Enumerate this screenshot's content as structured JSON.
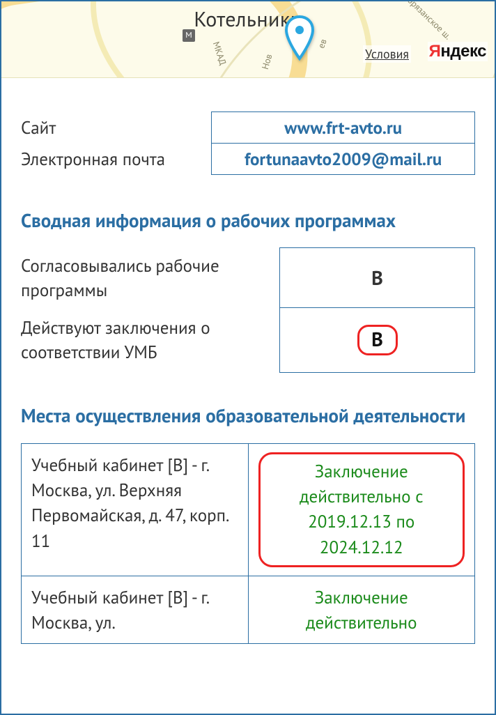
{
  "map": {
    "city": "Котельники",
    "conditions_label": "Условия",
    "provider_first": "Я",
    "provider_rest": "ндекс",
    "road_label_1": "Новорязанское ш.",
    "road_label_2": "МКАД",
    "road_label_3": "Нов",
    "road_label_4": "ев",
    "metro": "М"
  },
  "contacts": {
    "site_label": "Сайт",
    "site_value": "www.frt-avto.ru",
    "email_label": "Электронная почта",
    "email_value": "fortunaavto2009@mail.ru"
  },
  "sections": {
    "programs_title": "Сводная информация о рабочих программах",
    "places_title": "Места осуществления образовательной деятельности"
  },
  "programs": {
    "row1_label": "Согласовывались рабочие программы",
    "row1_value": "B",
    "row2_label": "Действуют заключения о соответствии УМБ",
    "row2_value": "B"
  },
  "places": [
    {
      "address": "Учебный кабинет [B] - г. Москва, ул. Верхняя Первомайская, д. 47, корп. 11",
      "status": "Заключение действительно с 2019.12.13 по 2024.12.12",
      "boxed": true
    },
    {
      "address": "Учебный кабинет [B] - г. Москва, ул.",
      "status": "Заключение действительно",
      "boxed": false
    }
  ]
}
